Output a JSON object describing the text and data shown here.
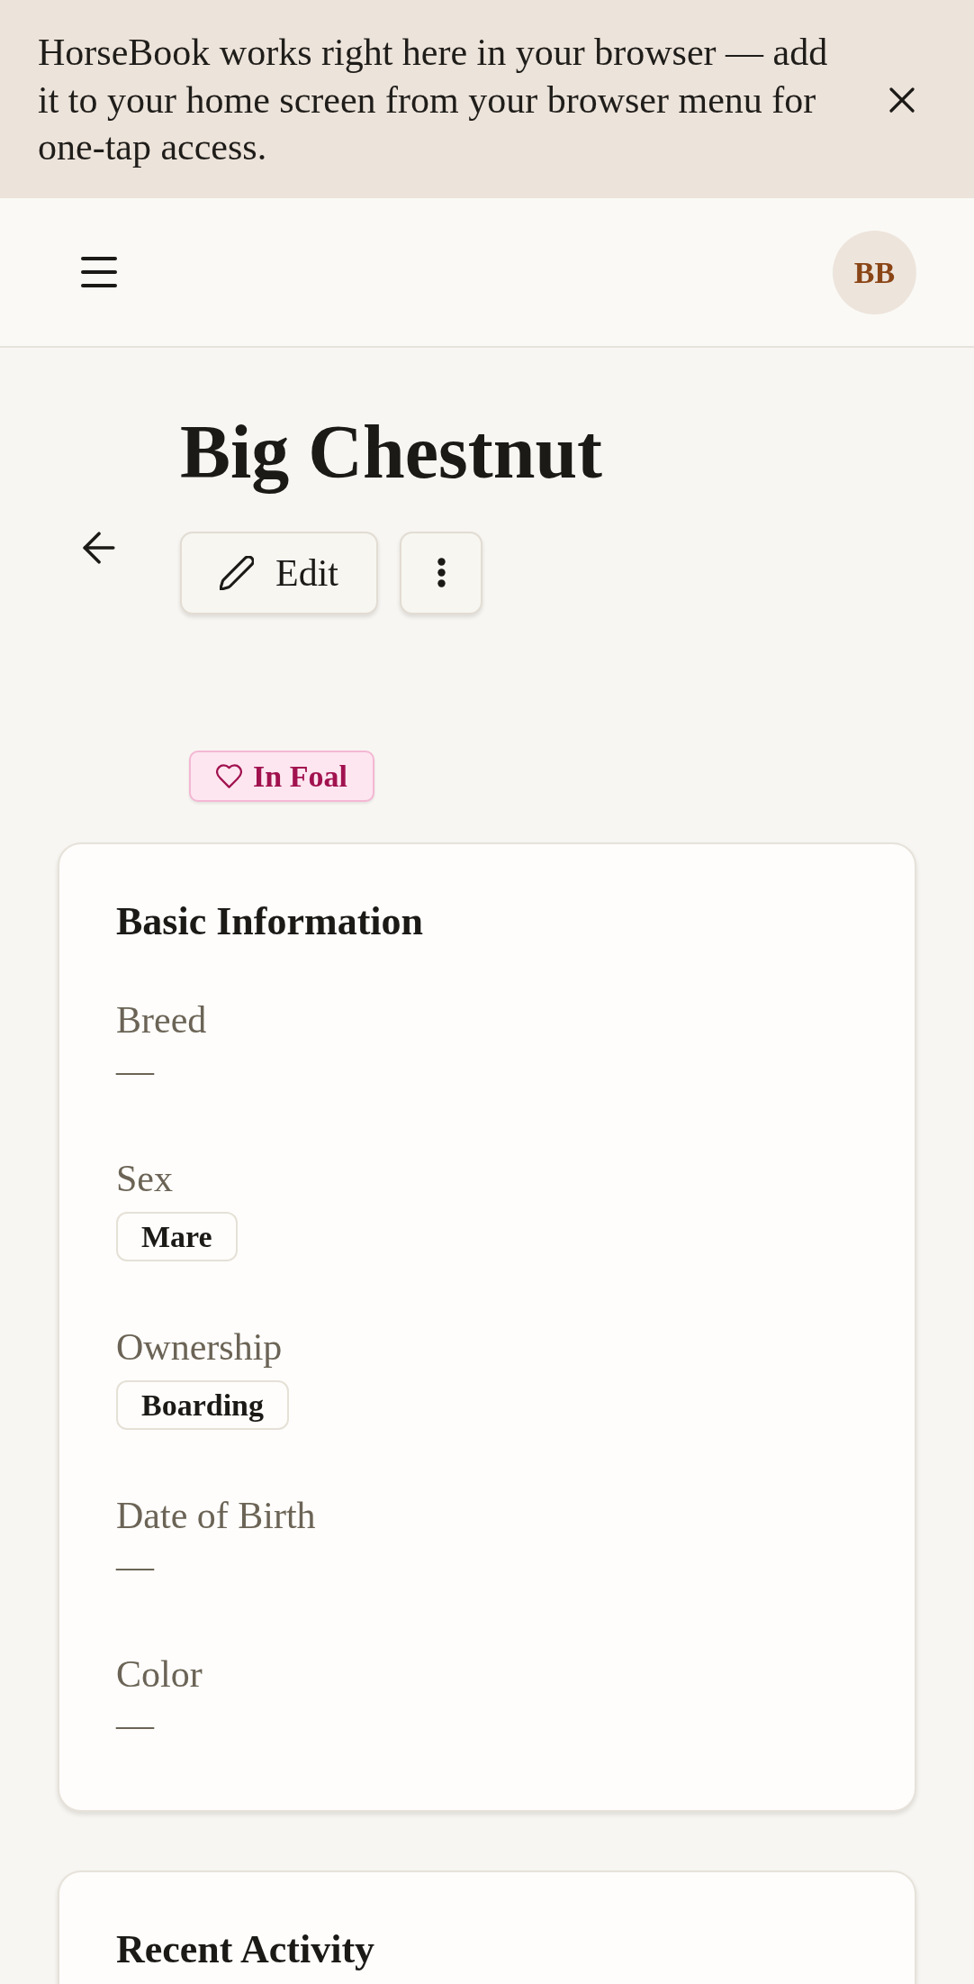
{
  "install_banner": {
    "message": "HorseBook works right here in your browser — add it to your home screen from your browser menu for one-tap access."
  },
  "top_bar": {
    "avatar_initials": "BB"
  },
  "horse": {
    "name": "Big Chestnut",
    "actions": [
      {
        "kind": "edit",
        "label": "Edit"
      },
      {
        "kind": "more"
      }
    ],
    "status_badge": {
      "label": "In Foal"
    }
  },
  "cards": [
    {
      "title": "Basic Information",
      "fields": [
        {
          "label": "Breed",
          "kind": "text",
          "value": "—"
        },
        {
          "label": "Sex",
          "kind": "tag",
          "value": "Mare"
        },
        {
          "label": "Ownership",
          "kind": "tag",
          "value": "Boarding"
        },
        {
          "label": "Date of Birth",
          "kind": "text",
          "value": "—"
        },
        {
          "label": "Color",
          "kind": "text",
          "value": "—"
        }
      ]
    },
    {
      "title": "Recent Activity"
    }
  ]
}
